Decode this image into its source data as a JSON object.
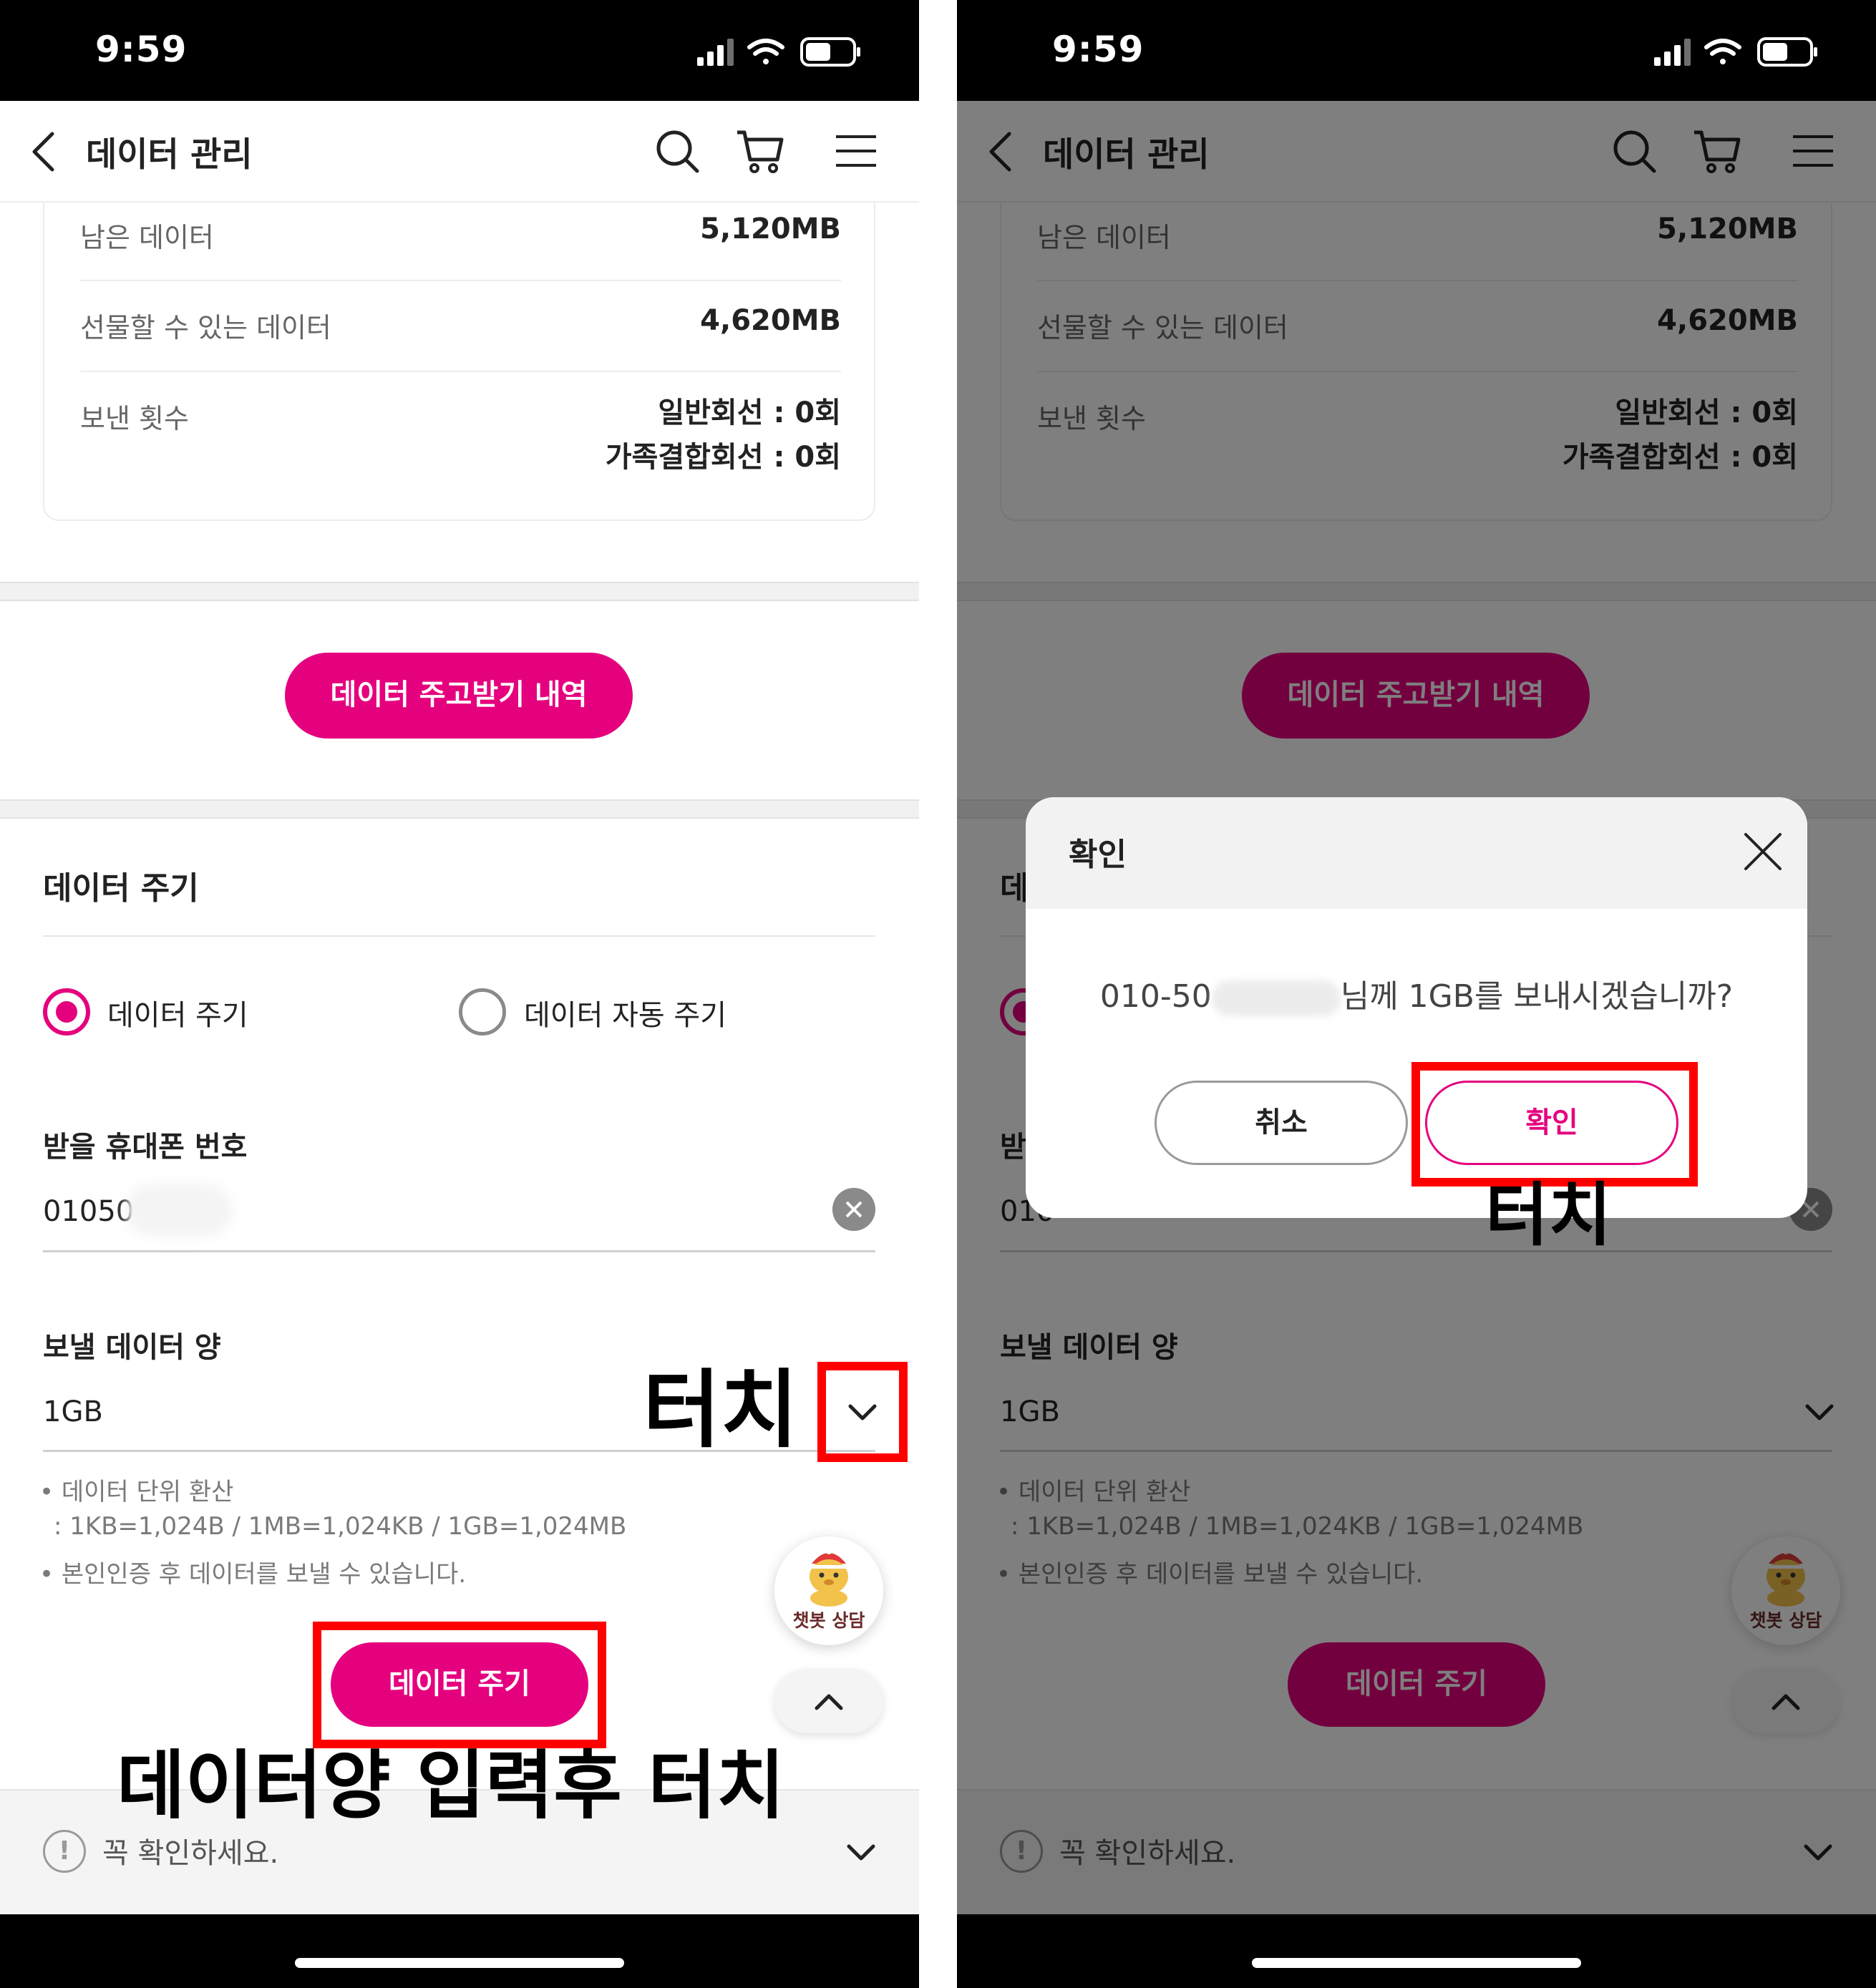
{
  "status": {
    "time": "9:59"
  },
  "header": {
    "title": "데이터 관리"
  },
  "info": {
    "remaining_label": "남은 데이터",
    "remaining_value": "5,120MB",
    "giftable_label": "선물할 수 있는 데이터",
    "giftable_value": "4,620MB",
    "sent_label": "보낸 횟수",
    "sent_general": "일반회선 : 0회",
    "sent_family": "가족결합회선 : 0회"
  },
  "history_button": "데이터 주고받기 내역",
  "give": {
    "section_title": "데이터 주기",
    "radio_give": "데이터 주기",
    "radio_auto": "데이터 자동 주기",
    "phone_label": "받을 휴대폰 번호",
    "phone_value": "01050",
    "phone_value_right": "010",
    "amount_label": "보낼 데이터 양",
    "amount_value": "1GB",
    "note_1": "• 데이터 단위 환산",
    "note_2": ": 1KB=1,024B / 1MB=1,024KB / 1GB=1,024MB",
    "note_3": "• 본인인증 후 데이터를 보낼 수 있습니다.",
    "submit_button": "데이터 주기"
  },
  "chatbot": {
    "label": "챗봇 상담"
  },
  "check_bar": {
    "text": "꼭 확인하세요.",
    "icon_glyph": "!"
  },
  "annotations": {
    "touch": "터치",
    "input_then_touch": "데이터양 입력후 터치"
  },
  "modal": {
    "title": "확인",
    "message_prefix": "010-50",
    "message_suffix": "님께 1GB를 보내시겠습니까?",
    "cancel": "취소",
    "confirm": "확인"
  },
  "colors": {
    "accent": "#e5007e",
    "highlight": "#ff0000"
  },
  "icons": [
    "back-chevron-icon",
    "search-icon",
    "cart-icon",
    "menu-icon",
    "chevron-down-icon",
    "chevron-up-icon",
    "clear-icon",
    "close-icon",
    "alert-icon",
    "signal-icon",
    "wifi-icon",
    "battery-icon"
  ]
}
